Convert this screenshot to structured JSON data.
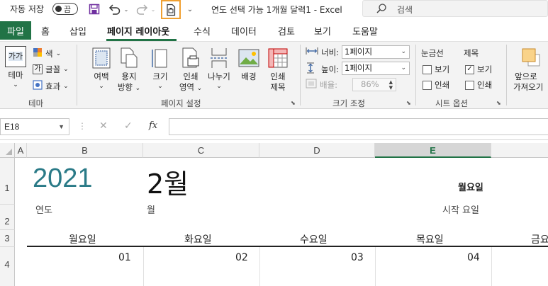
{
  "titlebar": {
    "autosave_label": "자동 저장",
    "autosave_state": "끔",
    "doc_title": "연도 선택 가능 1개월 달력1  -  Excel",
    "search_placeholder": "검색"
  },
  "ribbon_tabs": {
    "file": "파일",
    "home": "홈",
    "insert": "삽입",
    "page_layout": "페이지 레이아웃",
    "formulas": "수식",
    "data": "데이터",
    "review": "검토",
    "view": "보기",
    "help": "도움말"
  },
  "ribbon": {
    "themes": {
      "theme_btn": "테마",
      "theme_icon_text": "가가",
      "colors": "색",
      "fonts": "글꼴",
      "effects": "효과",
      "group": "테마"
    },
    "page_setup": {
      "margins": "여백",
      "orientation": [
        "용지",
        "방향"
      ],
      "size": "크기",
      "print_area": [
        "인쇄",
        "영역"
      ],
      "breaks": "나누기",
      "background": "배경",
      "print_titles": [
        "인쇄",
        "제목"
      ],
      "group": "페이지 설정"
    },
    "scale_to_fit": {
      "width_label": "너비:",
      "width_value": "1페이지",
      "height_label": "높이:",
      "height_value": "1페이지",
      "scale_label": "배율:",
      "scale_value": "86%",
      "group": "크기 조정"
    },
    "sheet_options": {
      "gridlines": "눈금선",
      "headings": "제목",
      "view": "보기",
      "print": "인쇄",
      "gridlines_view_checked": false,
      "gridlines_print_checked": false,
      "headings_view_checked": true,
      "headings_print_checked": false,
      "group": "시트 옵션"
    },
    "arrange": {
      "bring_forward": [
        "앞으로",
        "가져오기"
      ]
    }
  },
  "formula_bar": {
    "name_box": "E18",
    "cancel": "✕",
    "enter": "✓",
    "fx": "fx",
    "content": ""
  },
  "grid": {
    "columns": [
      "A",
      "B",
      "C",
      "D",
      "E"
    ],
    "rows": [
      "1",
      "2",
      "3",
      "4"
    ],
    "selected_column": "E",
    "year": "2021",
    "month": "2월",
    "start_day_value": "월요일",
    "year_label": "연도",
    "month_label": "월",
    "start_day_label": "시작 요일",
    "weekdays": [
      "월요일",
      "화요일",
      "수요일",
      "목요일",
      "금요"
    ],
    "dates": [
      "01",
      "02",
      "03",
      "04"
    ]
  },
  "colors": {
    "excel_green": "#217346",
    "year_teal": "#2a7a87",
    "highlight_orange": "#f0a030"
  }
}
